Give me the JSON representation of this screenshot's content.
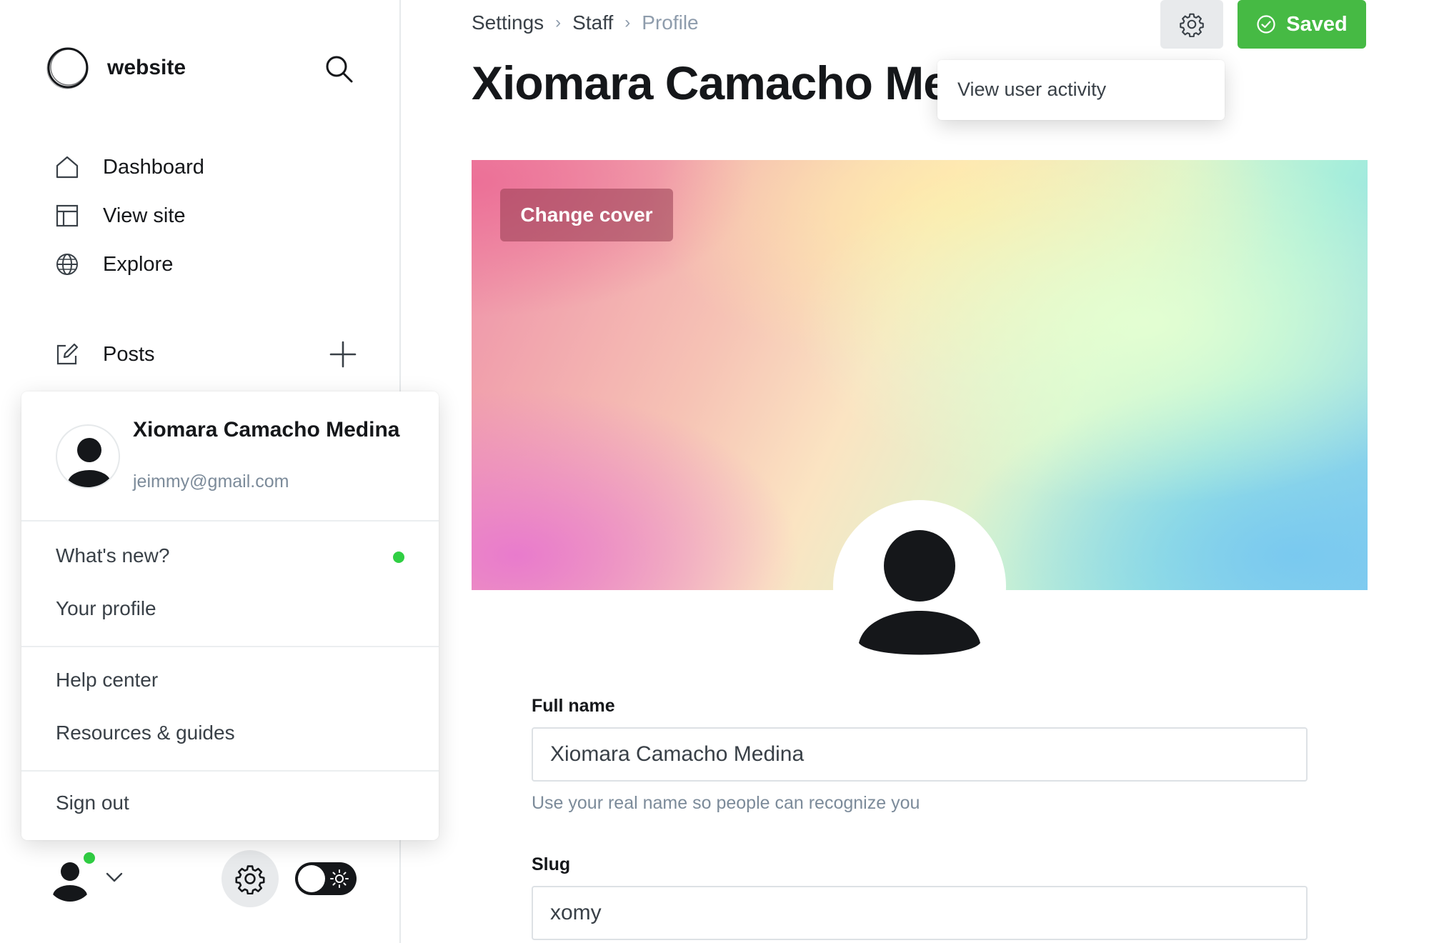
{
  "sidebar": {
    "brand": "website",
    "nav": [
      {
        "label": "Dashboard",
        "icon": "home-icon"
      },
      {
        "label": "View site",
        "icon": "layout-icon"
      },
      {
        "label": "Explore",
        "icon": "globe-icon"
      }
    ],
    "posts_label": "Posts"
  },
  "user_menu": {
    "name": "Xiomara Camacho Medina",
    "email": "jeimmy@gmail.com",
    "items": [
      "What's new?",
      "Your profile",
      "Help center",
      "Resources & guides",
      "Sign out"
    ]
  },
  "breadcrumb": [
    "Settings",
    "Staff",
    "Profile"
  ],
  "page_title": "Xiomara Camacho Medina",
  "header": {
    "saved_label": "Saved",
    "menu_item": "View user activity"
  },
  "cover": {
    "change_label": "Change cover"
  },
  "form": {
    "full_name": {
      "label": "Full name",
      "value": "Xiomara Camacho Medina",
      "hint": "Use your real name so people can recognize you"
    },
    "slug": {
      "label": "Slug",
      "value": "xomy"
    }
  },
  "colors": {
    "accent_green": "#46ba44",
    "online_dot": "#30cf43",
    "text_dark": "#15171a",
    "text_muted": "#7c8b9a"
  }
}
